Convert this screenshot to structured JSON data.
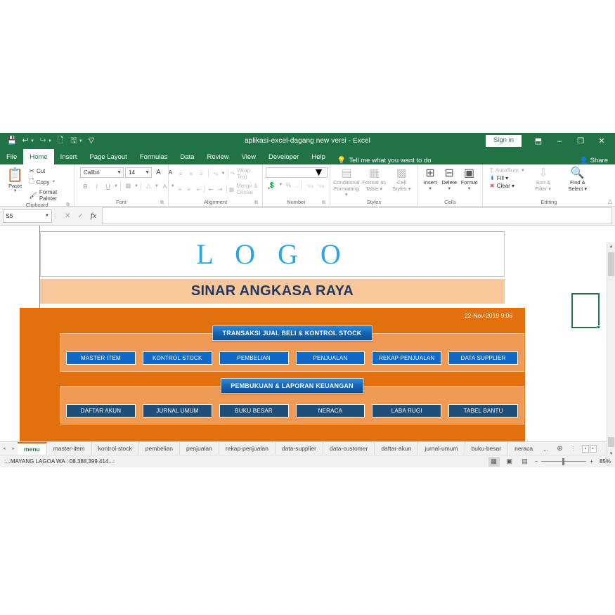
{
  "window": {
    "title": "aplikasi-excel-dagang new versi  -  Excel",
    "signin_label": "Sign in",
    "minimize": "–",
    "restore": "❐",
    "close": "✕",
    "ribbon_display": "⬒"
  },
  "qat": {
    "save": "💾",
    "undo": "↩",
    "redo": "↪",
    "print_preview": "🗋",
    "touch": "🖫",
    "customize": "▽"
  },
  "ribbon_tabs": [
    {
      "label": "File",
      "active": false
    },
    {
      "label": "Home",
      "active": true
    },
    {
      "label": "Insert",
      "active": false
    },
    {
      "label": "Page Layout",
      "active": false
    },
    {
      "label": "Formulas",
      "active": false
    },
    {
      "label": "Data",
      "active": false
    },
    {
      "label": "Review",
      "active": false
    },
    {
      "label": "View",
      "active": false
    },
    {
      "label": "Developer",
      "active": false
    },
    {
      "label": "Help",
      "active": false
    }
  ],
  "tellme": {
    "label": "Tell me what you want to do",
    "icon": "💡"
  },
  "share": {
    "label": "Share",
    "icon": "👤"
  },
  "groups": {
    "clipboard": {
      "label": "Clipboard",
      "paste": "Paste",
      "cut": "Cut",
      "copy": "Copy",
      "format_painter": "Format Painter"
    },
    "font": {
      "label": "Font",
      "font_name": "Calibri",
      "font_size": "14",
      "grow": "A",
      "shrink": "A",
      "bold": "B",
      "italic": "I",
      "underline": "U",
      "borders": "▦",
      "fill_color": "△",
      "font_color": "A"
    },
    "alignment": {
      "label": "Alignment",
      "wrap_text": "Wrap Text",
      "merge_center": "Merge & Center"
    },
    "number": {
      "label": "Number",
      "format_value": "",
      "accounting": "💲",
      "percent": "%",
      "comma": ",",
      "inc_dec": "·₀₀",
      "dec_dec": "·₀₀"
    },
    "styles": {
      "label": "Styles",
      "conditional": "Conditional\nFormatting",
      "conditional_l1": "Conditional",
      "conditional_l2": "Formatting ▾",
      "table_l1": "Format as",
      "table_l2": "Table ▾",
      "cellstyles_l1": "Cell",
      "cellstyles_l2": "Styles ▾"
    },
    "cells": {
      "label": "Cells",
      "insert": "Insert",
      "delete": "Delete",
      "format": "Format"
    },
    "editing": {
      "label": "Editing",
      "autosum": "AutoSum",
      "fill": "Fill ▾",
      "clear": "Clear ▾",
      "sort_l1": "Sort &",
      "sort_l2": "Filter ▾",
      "find_l1": "Find &",
      "find_l2": "Select ▾"
    }
  },
  "formula_bar": {
    "name_box": "S5",
    "cancel": "✕",
    "enter": "✓",
    "insert_function": "fx",
    "formula_value": ""
  },
  "sheet": {
    "logo_text": "L O G O",
    "company_name": "SINAR ANGKASA RAYA",
    "date_time": "22-Nov-2019 9:06",
    "sections": [
      {
        "heading": "TRANSAKSI JUAL BELI & KONTROL STOCK",
        "style": "blue",
        "buttons": [
          "MASTER ITEM",
          "KONTROL STOCK",
          "PEMBELIAN",
          "PENJUALAN",
          "REKAP PENJUALAN",
          "DATA SUPPLIER"
        ]
      },
      {
        "heading": "PEMBUKUAN & LAPORAN KEUANGAN",
        "style": "navy",
        "buttons": [
          "DAFTAR AKUN",
          "JURNAL UMUM",
          "BUKU BESAR",
          "NERACA",
          "LABA RUGI",
          "TABEL BANTU"
        ]
      }
    ]
  },
  "sheet_tabs": {
    "prev": "◂",
    "next": "▸",
    "overflow": "...",
    "add": "⊕",
    "menu_dots": "⋮",
    "scroll_left": "◂",
    "scroll_right": "▸",
    "items": [
      {
        "label": "menu",
        "active": true
      },
      {
        "label": "master-item",
        "active": false
      },
      {
        "label": "kontrol-stock",
        "active": false
      },
      {
        "label": "pembelian",
        "active": false
      },
      {
        "label": "penjualan",
        "active": false
      },
      {
        "label": "rekap-penjualan",
        "active": false
      },
      {
        "label": "data-supplier",
        "active": false
      },
      {
        "label": "data-customer",
        "active": false
      },
      {
        "label": "daftar-akun",
        "active": false
      },
      {
        "label": "jurnal-umum",
        "active": false
      },
      {
        "label": "buku-besar",
        "active": false
      },
      {
        "label": "neraca",
        "active": false
      }
    ]
  },
  "status_bar": {
    "message": ":...MAYANG LAGOA WA : 08.388.399.414...:",
    "view_normal": "▦",
    "view_pagelayout": "▣",
    "view_pagebreak": "▤",
    "zoom_out": "−",
    "zoom_in": "+",
    "zoom_level": "85%"
  },
  "colors": {
    "excel_green": "#217346",
    "panel_orange": "#E2700D",
    "section_orange": "#F09B55",
    "company_peach": "#F8C79A",
    "button_blue": "#1068C8",
    "button_navy": "#1F4E79",
    "logo_blue": "#2CA6DE",
    "company_text": "#1F3864"
  }
}
